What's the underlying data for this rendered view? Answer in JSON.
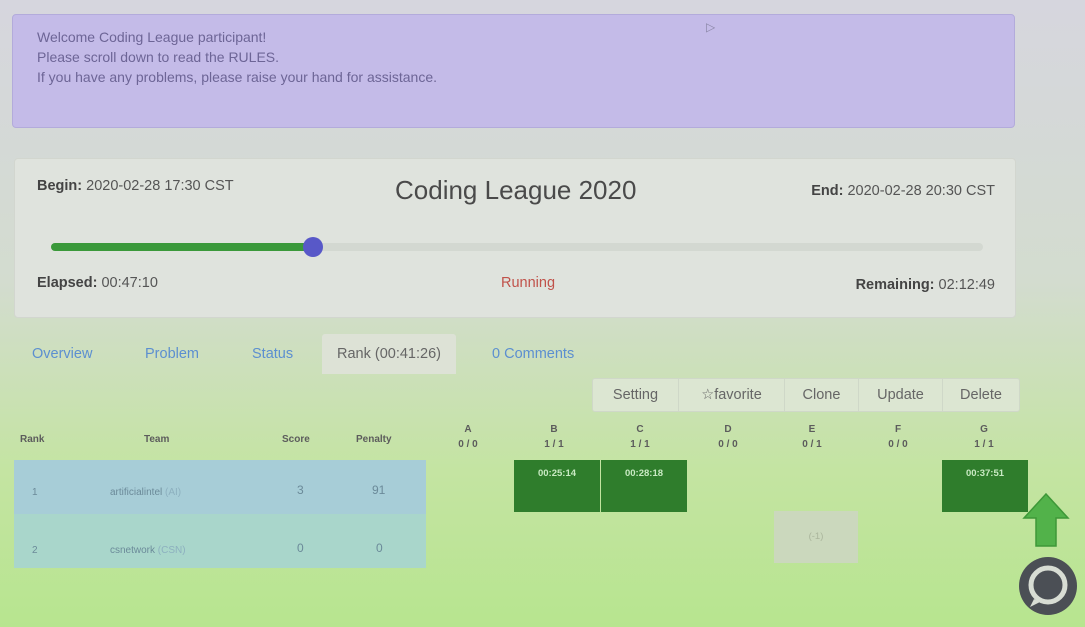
{
  "notice": {
    "lines": [
      "Welcome Coding League participant!",
      "Please scroll down to read the RULES.",
      "If you have any problems, please raise your hand for assistance."
    ]
  },
  "contest": {
    "begin_label": "Begin:",
    "begin_value": " 2020-02-28 17:30 CST",
    "title": "Coding League 2020",
    "end_label": "End:",
    "end_value": " 2020-02-28 20:30 CST",
    "progress_fraction": 0.2806,
    "elapsed_label": "Elapsed:",
    "elapsed_value": " 00:47:10",
    "status": "Running",
    "remaining_label": "Remaining:",
    "remaining_value": " 02:12:49",
    "progress_color": "#3a993a",
    "thumb_color": "#5858c8"
  },
  "tabs": {
    "overview": "Overview",
    "problem": "Problem",
    "status": "Status",
    "rank": "Rank (00:41:26)",
    "comments": "0 Comments"
  },
  "actions": {
    "setting": "Setting",
    "favorite": "☆favorite",
    "clone": "Clone",
    "update": "Update",
    "delete": "Delete"
  },
  "rank_table": {
    "headers": {
      "rank": "Rank",
      "team": "Team",
      "score": "Score",
      "penalty": "Penalty"
    },
    "problems": [
      {
        "id": "A",
        "stat": "0 / 0"
      },
      {
        "id": "B",
        "stat": "1 / 1"
      },
      {
        "id": "C",
        "stat": "1 / 1"
      },
      {
        "id": "D",
        "stat": "0 / 0"
      },
      {
        "id": "E",
        "stat": "0 / 1"
      },
      {
        "id": "F",
        "stat": "0 / 0"
      },
      {
        "id": "G",
        "stat": "1 / 1"
      }
    ],
    "rows": [
      {
        "rank": "1",
        "team": "artificialintel",
        "team_tag": "(AI)",
        "score": "3",
        "penalty": "91",
        "solved": {
          "B": "00:25:14",
          "C": "00:28:18",
          "G": "00:37:51"
        }
      },
      {
        "rank": "2",
        "team": "csnetwork",
        "team_tag": "(CSN)",
        "score": "0",
        "penalty": "0",
        "tried": {
          "E": "(-1)"
        }
      }
    ],
    "solved_color": "#2f7d2c"
  },
  "icons": {
    "scroll_top": "up-arrow-icon",
    "chat": "chat-icon"
  }
}
